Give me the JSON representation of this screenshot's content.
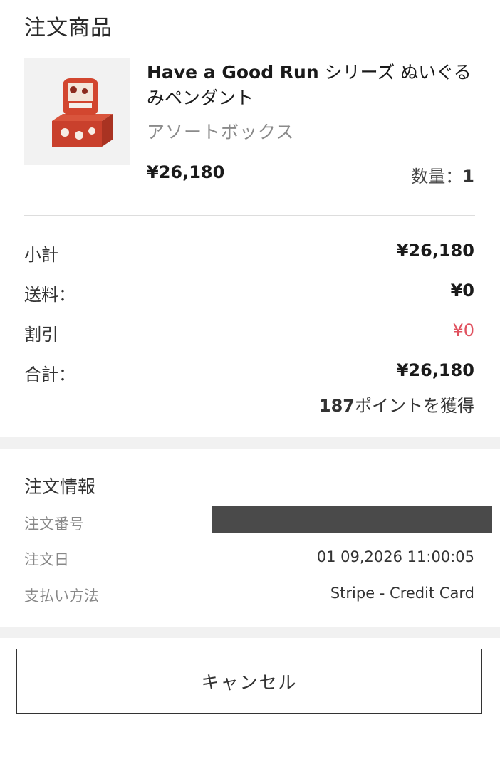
{
  "order_items": {
    "title": "注文商品",
    "product": {
      "image_icon": "product-box-image",
      "name_en": "Have a Good Run",
      "name_jp": " シリーズ ぬいぐるみペンダント",
      "variant": "アソートボックス",
      "price": "¥26,180",
      "qty_label": "数量：",
      "qty_value": "1"
    }
  },
  "summary": {
    "subtotal_label": "小計",
    "subtotal_value": "¥26,180",
    "shipping_label": "送料：",
    "shipping_value": "¥0",
    "discount_label": "割引",
    "discount_value": "¥0",
    "total_label": "合計：",
    "total_value": "¥26,180",
    "points_number": "187",
    "points_text": "ポイントを獲得"
  },
  "order_info": {
    "title": "注文情報",
    "order_number_label": "注文番号",
    "order_date_label": "注文日",
    "order_date_value": "01 09,2026 11:00:05",
    "payment_label": "支払い方法",
    "payment_value": "Stripe - Credit Card"
  },
  "actions": {
    "cancel_label": "キャンセル"
  },
  "colors": {
    "discount": "#e0505e",
    "band": "#f1f1f1",
    "redaction": "#4a4a4a"
  }
}
